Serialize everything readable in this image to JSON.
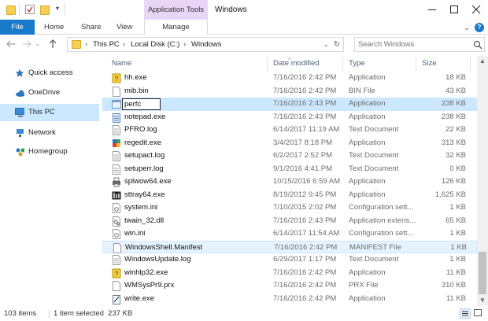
{
  "window": {
    "title": "Windows",
    "context_tab": "Application Tools",
    "controls": [
      "minimize-icon",
      "maximize-icon",
      "close-icon"
    ]
  },
  "ribbon": {
    "tabs": [
      "File",
      "Home",
      "Share",
      "View"
    ],
    "manage_tab": "Manage"
  },
  "address_bar": {
    "breadcrumbs": [
      "This PC",
      "Local Disk (C:)",
      "Windows"
    ],
    "search_placeholder": "Search Windows"
  },
  "sidebar": {
    "items": [
      {
        "label": "Quick access",
        "icon": "star-icon",
        "selected": false
      },
      {
        "label": "OneDrive",
        "icon": "cloud-icon",
        "selected": false
      },
      {
        "label": "This PC",
        "icon": "computer-icon",
        "selected": true
      },
      {
        "label": "Network",
        "icon": "network-icon",
        "selected": false
      },
      {
        "label": "Homegroup",
        "icon": "homegroup-icon",
        "selected": false
      }
    ]
  },
  "columns": [
    "Name",
    "Date modified",
    "Type",
    "Size"
  ],
  "files": [
    {
      "name": "hh.exe",
      "date": "7/16/2016 2:42 PM",
      "type": "Application",
      "size": "18 KB",
      "icon": "help-exe-icon"
    },
    {
      "name": "mib.bin",
      "date": "7/16/2016 2:42 PM",
      "type": "BIN File",
      "size": "43 KB",
      "icon": "file-icon"
    },
    {
      "name": "perfc",
      "date": "7/16/2016 2:43 PM",
      "type": "Application",
      "size": "238 KB",
      "icon": "app-window-icon",
      "renaming": true
    },
    {
      "name": "notepad.exe",
      "date": "7/16/2016 2:43 PM",
      "type": "Application",
      "size": "238 KB",
      "icon": "notepad-icon"
    },
    {
      "name": "PFRO.log",
      "date": "6/14/2017 11:19 AM",
      "type": "Text Document",
      "size": "22 KB",
      "icon": "text-file-icon"
    },
    {
      "name": "regedit.exe",
      "date": "3/4/2017 8:18 PM",
      "type": "Application",
      "size": "313 KB",
      "icon": "regedit-icon"
    },
    {
      "name": "setupact.log",
      "date": "6/2/2017 2:52 PM",
      "type": "Text Document",
      "size": "32 KB",
      "icon": "text-file-icon"
    },
    {
      "name": "setuperr.log",
      "date": "9/1/2016 4:41 PM",
      "type": "Text Document",
      "size": "0 KB",
      "icon": "text-file-icon"
    },
    {
      "name": "splwow64.exe",
      "date": "10/15/2016 6:59 AM",
      "type": "Application",
      "size": "126 KB",
      "icon": "printer-icon"
    },
    {
      "name": "sttray64.exe",
      "date": "8/19/2012 9:45 PM",
      "type": "Application",
      "size": "1,625 KB",
      "icon": "audio-icon"
    },
    {
      "name": "system.ini",
      "date": "7/10/2015 2:02 PM",
      "type": "Configuration sett...",
      "size": "1 KB",
      "icon": "config-icon"
    },
    {
      "name": "twain_32.dll",
      "date": "7/16/2016 2:43 PM",
      "type": "Application extens...",
      "size": "65 KB",
      "icon": "dll-icon"
    },
    {
      "name": "win.ini",
      "date": "6/14/2017 11:54 AM",
      "type": "Configuration sett...",
      "size": "1 KB",
      "icon": "config-icon"
    },
    {
      "name": "WindowsShell.Manifest",
      "date": "7/16/2016 2:42 PM",
      "type": "MANIFEST File",
      "size": "1 KB",
      "icon": "file-icon",
      "hover": true
    },
    {
      "name": "WindowsUpdate.log",
      "date": "6/29/2017 1:17 PM",
      "type": "Text Document",
      "size": "1 KB",
      "icon": "text-file-icon"
    },
    {
      "name": "winhlp32.exe",
      "date": "7/16/2016 2:42 PM",
      "type": "Application",
      "size": "11 KB",
      "icon": "help-exe-icon"
    },
    {
      "name": "WMSysPr9.prx",
      "date": "7/16/2016 2:42 PM",
      "type": "PRX File",
      "size": "310 KB",
      "icon": "file-icon"
    },
    {
      "name": "write.exe",
      "date": "7/16/2016 2:42 PM",
      "type": "Application",
      "size": "11 KB",
      "icon": "write-icon"
    }
  ],
  "status": {
    "item_count": "103 items",
    "selection": "1 item selected  237 KB"
  },
  "colors": {
    "file_tab": "#1979ca",
    "context_tab": "#e9d6f6",
    "selection": "#cce8ff",
    "hover": "#e5f3ff"
  }
}
